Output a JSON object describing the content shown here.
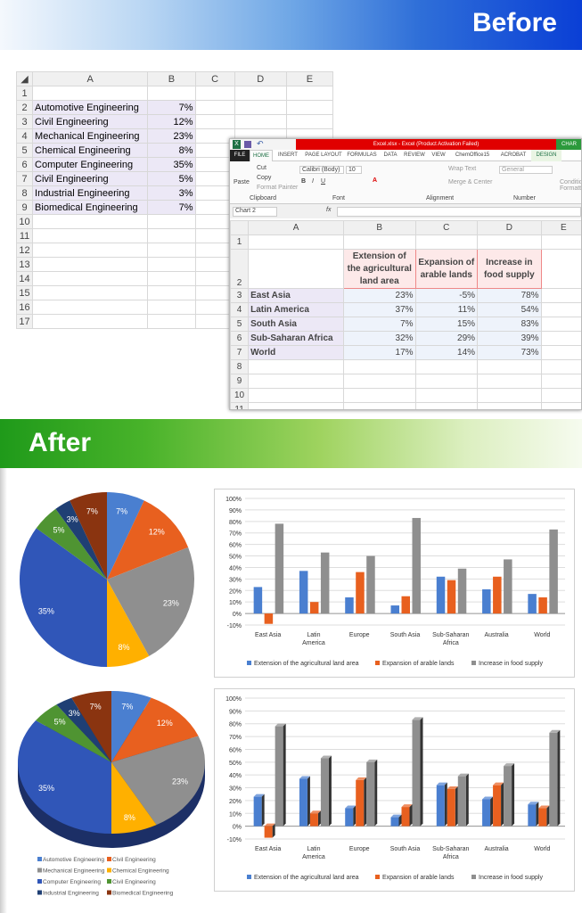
{
  "before_title": "Before",
  "after_title": "After",
  "sheet1": {
    "columns": [
      "A",
      "B",
      "C",
      "D",
      "E"
    ],
    "rows": [
      {
        "n": "1",
        "a": "",
        "b": ""
      },
      {
        "n": "2",
        "a": "Automotive Engineering",
        "b": "7%"
      },
      {
        "n": "3",
        "a": "Civil Engineering",
        "b": "12%"
      },
      {
        "n": "4",
        "a": "Mechanical Engineering",
        "b": "23%"
      },
      {
        "n": "5",
        "a": "Chemical Engineering",
        "b": "8%"
      },
      {
        "n": "6",
        "a": "Computer Engineering",
        "b": "35%"
      },
      {
        "n": "7",
        "a": "Civil Engineering",
        "b": "5%"
      },
      {
        "n": "8",
        "a": "Industrial Engineering",
        "b": "3%"
      },
      {
        "n": "9",
        "a": "Biomedical Engineering",
        "b": "7%"
      },
      {
        "n": "10",
        "a": "",
        "b": ""
      },
      {
        "n": "11",
        "a": "",
        "b": ""
      },
      {
        "n": "12",
        "a": "",
        "b": ""
      },
      {
        "n": "13",
        "a": "",
        "b": ""
      },
      {
        "n": "14",
        "a": "",
        "b": ""
      },
      {
        "n": "15",
        "a": "",
        "b": ""
      },
      {
        "n": "16",
        "a": "",
        "b": ""
      },
      {
        "n": "17",
        "a": "",
        "b": ""
      }
    ]
  },
  "excel": {
    "title": "Excel.xlsx - Excel (Product Activation Failed)",
    "context_tab": "CHAR",
    "tabs": [
      "FILE",
      "HOME",
      "INSERT",
      "PAGE LAYOUT",
      "FORMULAS",
      "DATA",
      "REVIEW",
      "VIEW",
      "ChemOffice15",
      "ACROBAT",
      "DESIGN"
    ],
    "clipboard": {
      "paste": "Paste",
      "cut": "Cut",
      "copy": "Copy",
      "format_painter": "Format Painter",
      "group": "Clipboard"
    },
    "font": {
      "name": "Calibri (Body)",
      "size": "10",
      "group": "Font"
    },
    "alignment": {
      "wrap": "Wrap Text",
      "merge": "Merge & Center",
      "group": "Alignment"
    },
    "number": {
      "format": "General",
      "group": "Number"
    },
    "cond": "Conditional Formatting",
    "name_box": "Chart 2",
    "columns": [
      "A",
      "B",
      "C",
      "D",
      "E"
    ],
    "headers": [
      "Extension of the agricultural land area",
      "Expansion of arable lands",
      "Increase in food supply"
    ],
    "rows": [
      {
        "n": "3",
        "region": "East Asia",
        "b": "23%",
        "c": "-5%",
        "d": "78%"
      },
      {
        "n": "4",
        "region": "Latin America",
        "b": "37%",
        "c": "11%",
        "d": "54%"
      },
      {
        "n": "5",
        "region": "South Asia",
        "b": "7%",
        "c": "15%",
        "d": "83%"
      },
      {
        "n": "6",
        "region": "Sub-Saharan Africa",
        "b": "32%",
        "c": "29%",
        "d": "39%"
      },
      {
        "n": "7",
        "region": "World",
        "b": "17%",
        "c": "14%",
        "d": "73%"
      }
    ],
    "empty_rows": [
      "8",
      "9",
      "10",
      "11"
    ]
  },
  "chart_data": [
    {
      "type": "pie",
      "labels": [
        "Automotive Engineering",
        "Civil Engineering",
        "Mechanical Engineering",
        "Chemical Engineering",
        "Computer Engineering",
        "Civil Engineering",
        "Industrial Engineering",
        "Biomedical Engineering"
      ],
      "values": [
        7,
        12,
        23,
        8,
        35,
        5,
        3,
        7
      ],
      "data_labels": [
        "7%",
        "12%",
        "23%",
        "8%",
        "35%",
        "5%",
        "3%",
        "7%"
      ],
      "colors": [
        "#4a7fd0",
        "#e8601f",
        "#8f8f8f",
        "#ffb000",
        "#3056b8",
        "#4f9432",
        "#1f3f74",
        "#8a3410"
      ],
      "legend": "none"
    },
    {
      "type": "bar",
      "categories": [
        "East Asia",
        "Latin America",
        "Europe",
        "South Asia",
        "Sub-Saharan Africa",
        "Australia",
        "World"
      ],
      "series": [
        {
          "name": "Extension of the agricultural land area",
          "values": [
            23,
            37,
            14,
            7,
            32,
            21,
            17
          ],
          "color": "#4a7fd0"
        },
        {
          "name": "Expansion of arable lands",
          "values": [
            -9,
            10,
            36,
            15,
            29,
            32,
            14
          ],
          "color": "#e8601f"
        },
        {
          "name": "Increase in food supply",
          "values": [
            78,
            53,
            50,
            83,
            39,
            47,
            73
          ],
          "color": "#8f8f8f"
        }
      ],
      "ylim": [
        -10,
        100
      ],
      "yticks": [
        "-10%",
        "0%",
        "10%",
        "20%",
        "30%",
        "40%",
        "50%",
        "60%",
        "70%",
        "80%",
        "90%",
        "100%"
      ],
      "grid": true,
      "legend": "bottom"
    },
    {
      "type": "pie",
      "style": "3d",
      "labels": [
        "Automotive Engineering",
        "Civil Engineering",
        "Mechanical Engineering",
        "Chemical Engineering",
        "Computer Engineering",
        "Civil Engineering",
        "Industrial Engineering",
        "Biomedical Engineering"
      ],
      "values": [
        7,
        12,
        23,
        8,
        35,
        5,
        3,
        7
      ],
      "data_labels": [
        "7%",
        "12%",
        "23%",
        "8%",
        "35%",
        "5%",
        "3%",
        "7%"
      ],
      "legend": "bottom"
    },
    {
      "type": "bar",
      "style": "3d",
      "categories": [
        "East Asia",
        "Latin America",
        "Europe",
        "South Asia",
        "Sub-Saharan Africa",
        "Australia",
        "World"
      ],
      "series": [
        {
          "name": "Extension of the agricultural land area",
          "values": [
            23,
            37,
            14,
            7,
            32,
            21,
            17
          ]
        },
        {
          "name": "Expansion of arable lands",
          "values": [
            -9,
            10,
            36,
            15,
            29,
            32,
            14
          ]
        },
        {
          "name": "Increase in food supply",
          "values": [
            78,
            53,
            50,
            83,
            39,
            47,
            73
          ]
        }
      ],
      "ylim": [
        -10,
        100
      ],
      "grid": true,
      "legend": "bottom"
    }
  ]
}
